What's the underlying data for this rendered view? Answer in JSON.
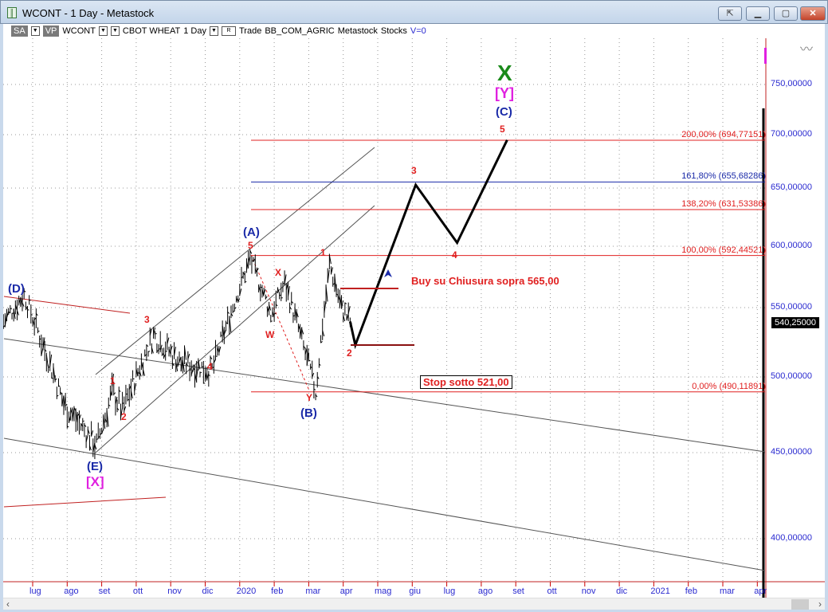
{
  "window": {
    "title": "WCONT - 1 Day - Metastock",
    "buttons": [
      "restore-out",
      "minimize",
      "maximize",
      "close"
    ]
  },
  "toolbar": {
    "sa": "SA",
    "vp": "VP",
    "symbol": "WCONT",
    "name": "CBOT WHEAT",
    "period": "1 Day",
    "r": "R",
    "mode": "Trade",
    "list": "BB_COM_AGRIC",
    "source": "Metastock",
    "type": "Stocks",
    "v": "V=0"
  },
  "chart_data": {
    "type": "line",
    "title": "WCONT - CBOT WHEAT - 1 Day",
    "y_ticks": [
      {
        "v": 750,
        "label": "750,00000"
      },
      {
        "v": 700,
        "label": "700,00000"
      },
      {
        "v": 650,
        "label": "650,00000"
      },
      {
        "v": 600,
        "label": "600,00000"
      },
      {
        "v": 550,
        "label": "550,00000"
      },
      {
        "v": 500,
        "label": "500,00000"
      },
      {
        "v": 450,
        "label": "450,00000"
      },
      {
        "v": 400,
        "label": "400,00000"
      }
    ],
    "x_ticks": [
      "lug",
      "ago",
      "set",
      "ott",
      "nov",
      "dic",
      "2020",
      "feb",
      "mar",
      "apr",
      "mag",
      "giu",
      "lug",
      "ago",
      "set",
      "ott",
      "nov",
      "dic",
      "2021",
      "feb",
      "mar",
      "apr"
    ],
    "last_price": "540,25000",
    "price_path": {
      "month_index": [
        -0.85,
        -0.25,
        0.9,
        1.85,
        2.3,
        2.6,
        3.5,
        4.3,
        5.2,
        6.3,
        6.9,
        7.3,
        8.2,
        8.6,
        8.95,
        9.2
      ],
      "price": [
        540,
        560,
        482,
        455,
        490,
        478,
        530,
        510,
        505,
        590,
        545,
        570,
        490,
        585,
        550,
        540
      ]
    },
    "projection": {
      "month_index": [
        9.2,
        9.35,
        11.1,
        12.3,
        13.75
      ],
      "price": [
        540,
        523,
        653,
        603,
        695
      ]
    },
    "fib_levels": [
      {
        "label": "200,00% (694,77151)",
        "v": 694.77,
        "color": "#e02020"
      },
      {
        "label": "161,80% (655,68286)",
        "v": 655.68,
        "color": "#1a2aa8"
      },
      {
        "label": "138,20% (631,53386)",
        "v": 631.53,
        "color": "#e02020"
      },
      {
        "label": "100,00% (592,44521)",
        "v": 592.45,
        "color": "#e02020"
      },
      {
        "label": "0,00% (490,11891)",
        "v": 490.12,
        "color": "#e02020"
      }
    ]
  },
  "annotations": {
    "d": "(D)",
    "e": "(E)",
    "x_bracket": "[X]",
    "a": "(A)",
    "b": "(B)",
    "c": "(C)",
    "y_bracket": "[Y]",
    "x_big": "X",
    "w1": "1",
    "w2": "2",
    "w3": "3",
    "w4": "4",
    "w5": "5",
    "W": "W",
    "X": "X",
    "Y": "Y",
    "r1": "1",
    "p2": "2",
    "p3": "3",
    "p4": "4",
    "p5": "5",
    "buy": "Buy su Chiusura sopra 565,00",
    "stop": "Stop sotto 521,00"
  }
}
